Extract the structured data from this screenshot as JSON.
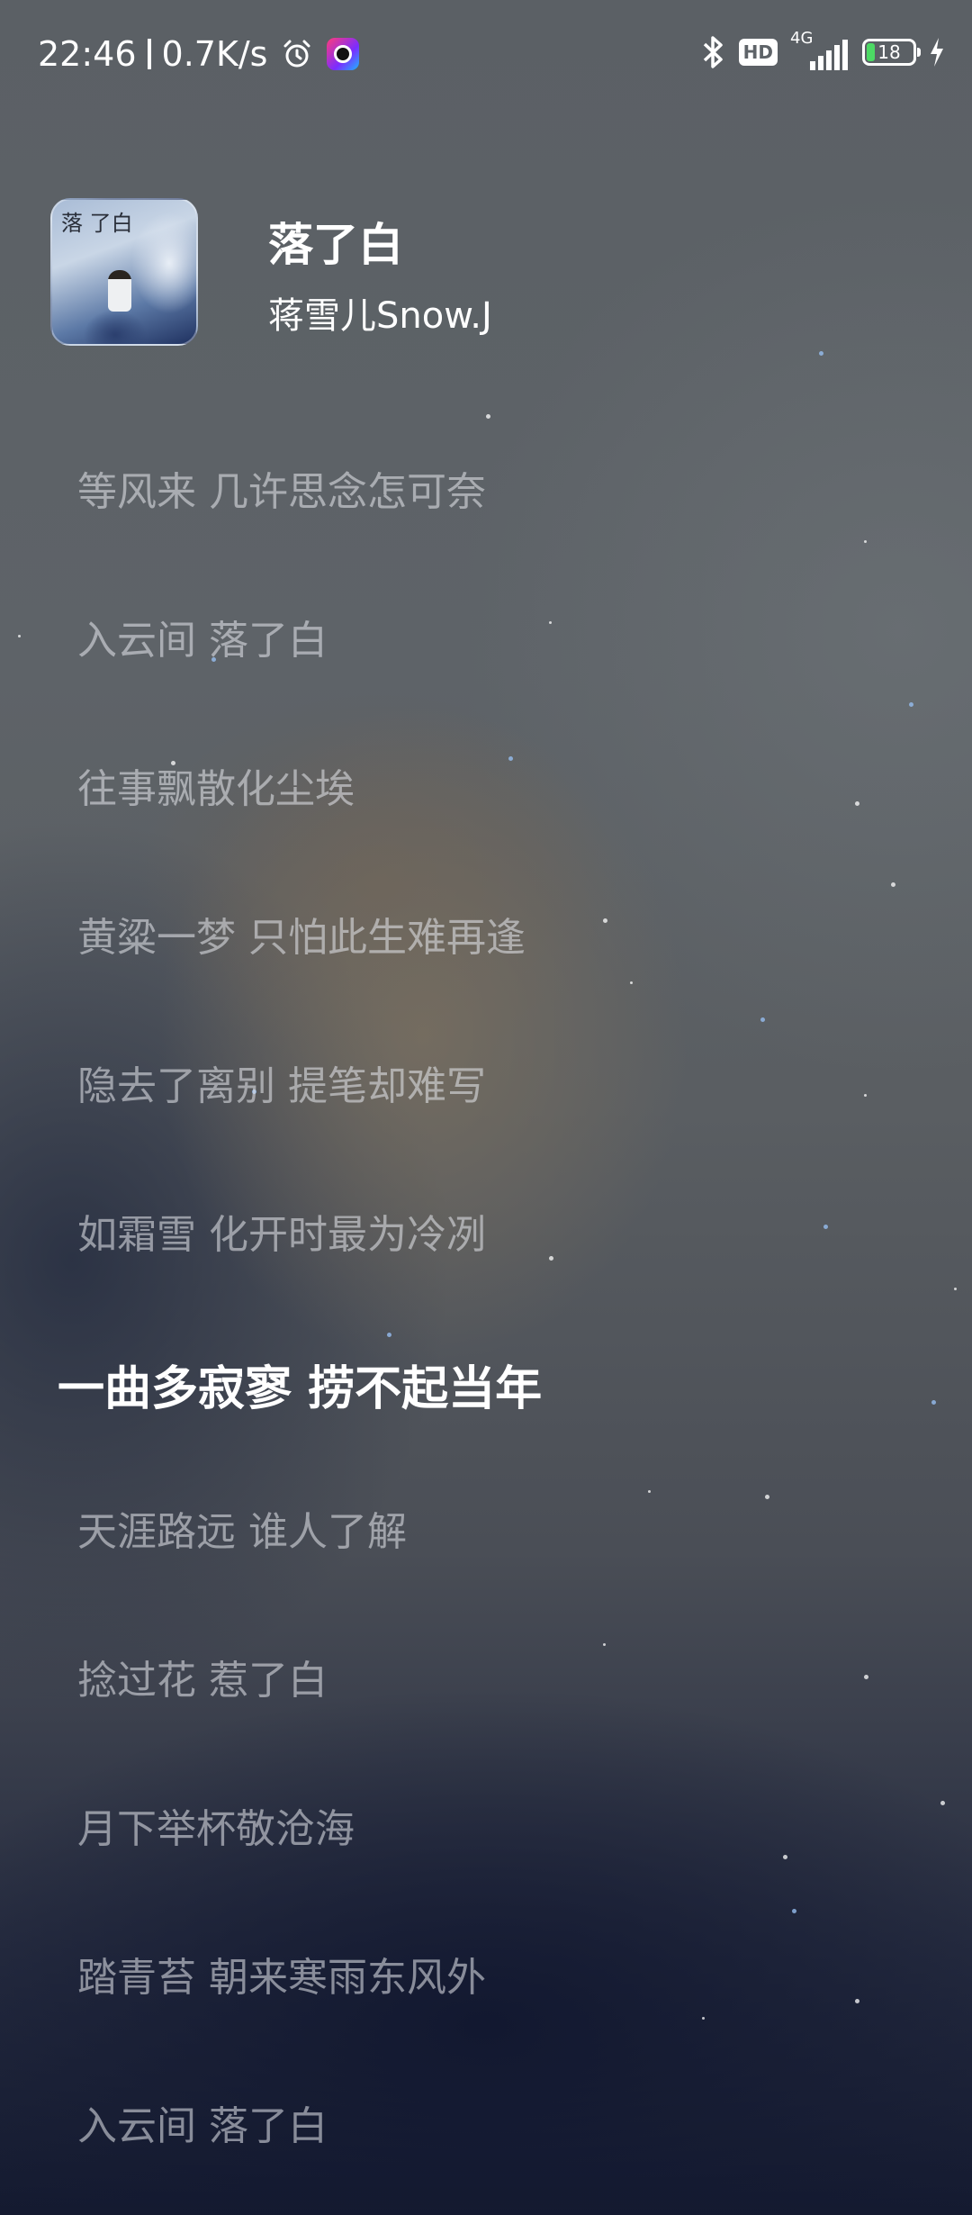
{
  "status_bar": {
    "time": "22:46",
    "net_speed": "0.7K/s",
    "alarm_icon": "alarm-clock-icon",
    "app_icon": "app-notification-icon",
    "bluetooth_icon": "bluetooth-icon",
    "hd_label": "HD",
    "network_type": "4G",
    "battery_level": "18",
    "battery_fraction": 0.18,
    "charging_icon": "lightning-bolt-icon"
  },
  "song": {
    "cover_title": "落 了白",
    "title": "落了白",
    "artist": "蒋雪儿Snow.J"
  },
  "lyrics": {
    "lines": [
      "等风来 几许思念怎可奈",
      "入云间 落了白",
      "往事飘散化尘埃",
      "黄粱一梦 只怕此生难再逢",
      "隐去了离别 提笔却难写",
      "如霜雪 化开时最为冷冽",
      "一曲多寂寥 捞不起当年",
      "天涯路远 谁人了解",
      "捻过花 惹了白",
      "月下举杯敬沧海",
      "踏青苔 朝来寒雨东风外",
      "入云间 落了白"
    ],
    "active_index": 6
  },
  "colors": {
    "active_lyric": "#ffffff",
    "inactive_lyric": "#e8eaee",
    "battery_fill": "#4cd964"
  }
}
